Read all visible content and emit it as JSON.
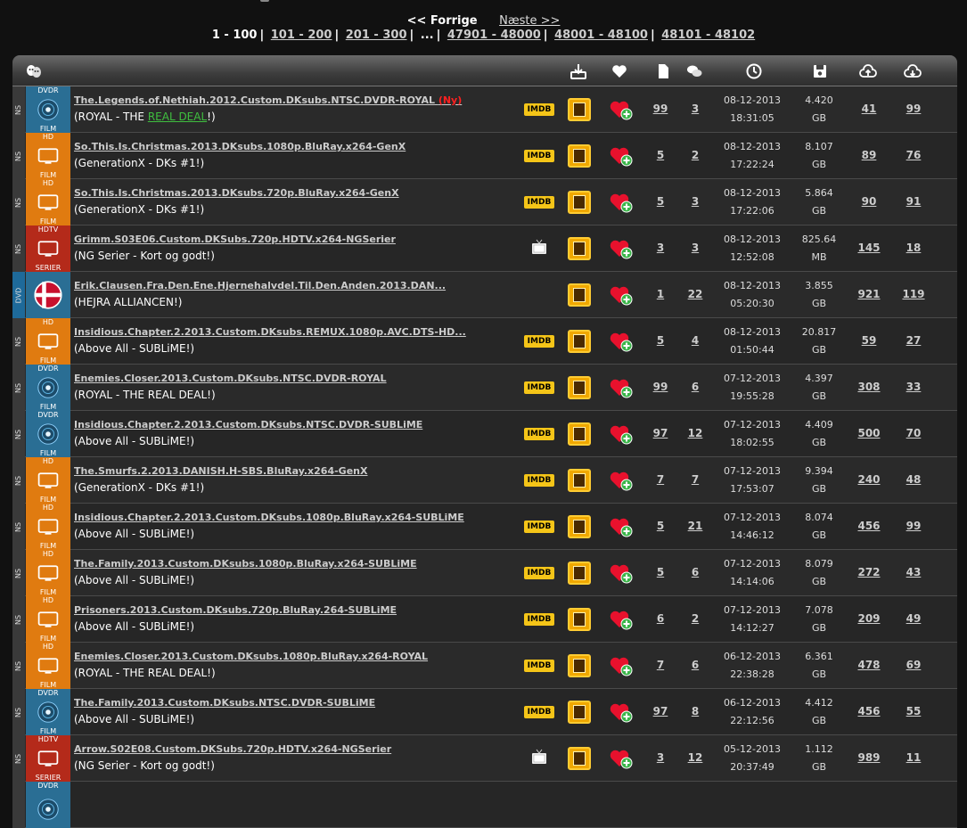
{
  "pager": {
    "prev": "<< Forrige",
    "next": "Næste >>",
    "current": "1 - 100",
    "pages": [
      "101 - 200",
      "201 - 300",
      "...",
      "47901 - 48000",
      "48001 - 48100",
      "48101 - 48102"
    ]
  },
  "header_icons": [
    "masks-icon",
    "download-icon",
    "heart-icon",
    "file-icon",
    "comments-icon",
    "clock-icon",
    "save-icon",
    "upload-cloud-icon",
    "download-cloud-icon"
  ],
  "rows": [
    {
      "side": "NS",
      "cat_top": "DVDR",
      "cat_bottom": "FILM",
      "cat": "blue",
      "icon": "disc",
      "title": "The.Legends.of.Nethiah.2012.Custom.DKsubs.NTSC.DVDR-ROYAL",
      "badge": "(Ny)",
      "sub": "(ROYAL - THE ",
      "sub_green": "REAL DEAL",
      "sub_end": "!)",
      "media": "imdb",
      "files": "99",
      "comments": "3",
      "date": "08-12-2013",
      "time": "18:31:05",
      "size": "4.420",
      "unit": "GB",
      "seeders": "41",
      "leechers": "99"
    },
    {
      "side": "NS",
      "cat_top": "HD",
      "cat_bottom": "FILM",
      "cat": "orange",
      "icon": "tv",
      "title": "So.This.Is.Christmas.2013.DKsubs.1080p.BluRay.x264-GenX",
      "badge": "",
      "sub": "(GenerationX - DKs #1!)",
      "sub_green": "",
      "sub_end": "",
      "media": "imdb",
      "files": "5",
      "comments": "2",
      "date": "08-12-2013",
      "time": "17:22:24",
      "size": "8.107",
      "unit": "GB",
      "seeders": "89",
      "leechers": "76"
    },
    {
      "side": "NS",
      "cat_top": "HD",
      "cat_bottom": "FILM",
      "cat": "orange",
      "icon": "tv",
      "title": "So.This.Is.Christmas.2013.DKsubs.720p.BluRay.x264-GenX",
      "badge": "",
      "sub": "(GenerationX - DKs #1!)",
      "sub_green": "",
      "sub_end": "",
      "media": "imdb",
      "files": "5",
      "comments": "3",
      "date": "08-12-2013",
      "time": "17:22:06",
      "size": "5.864",
      "unit": "GB",
      "seeders": "90",
      "leechers": "91"
    },
    {
      "side": "NS",
      "cat_top": "HDTV",
      "cat_bottom": "SERIER",
      "cat": "red",
      "icon": "tv",
      "title": "Grimm.S03E06.Custom.DKSubs.720p.HDTV.x264-NGSerier",
      "badge": "",
      "sub": "(NG Serier - Kort og godt!)",
      "sub_green": "",
      "sub_end": "",
      "media": "tv",
      "files": "3",
      "comments": "3",
      "date": "08-12-2013",
      "time": "12:52:08",
      "size": "825.64",
      "unit": "MB",
      "seeders": "145",
      "leechers": "18"
    },
    {
      "side": "DVD",
      "cat_top": "",
      "cat_bottom": "",
      "cat": "dk",
      "icon": "flag",
      "title": "Erik.Clausen.Fra.Den.Ene.Hjernehalvdel.Til.Den.Anden.2013.DAN...",
      "badge": "",
      "sub": "(HEJRA ALLIANCEN!)",
      "sub_green": "",
      "sub_end": "",
      "media": "",
      "files": "1",
      "comments": "22",
      "date": "08-12-2013",
      "time": "05:20:30",
      "size": "3.855",
      "unit": "GB",
      "seeders": "921",
      "leechers": "119"
    },
    {
      "side": "NS",
      "cat_top": "HD",
      "cat_bottom": "FILM",
      "cat": "orange",
      "icon": "tv",
      "title": "Insidious.Chapter.2.2013.Custom.DKsubs.REMUX.1080p.AVC.DTS-HD...",
      "badge": "",
      "sub": "(Above All - SUBLiME!)",
      "sub_green": "",
      "sub_end": "",
      "media": "imdb",
      "files": "5",
      "comments": "4",
      "date": "08-12-2013",
      "time": "01:50:44",
      "size": "20.817",
      "unit": "GB",
      "seeders": "59",
      "leechers": "27"
    },
    {
      "side": "NS",
      "cat_top": "DVDR",
      "cat_bottom": "FILM",
      "cat": "blue",
      "icon": "disc",
      "title": "Enemies.Closer.2013.Custom.DKsubs.NTSC.DVDR-ROYAL",
      "badge": "",
      "sub": "(ROYAL - THE REAL DEAL!)",
      "sub_green": "",
      "sub_end": "",
      "media": "imdb",
      "files": "99",
      "comments": "6",
      "date": "07-12-2013",
      "time": "19:55:28",
      "size": "4.397",
      "unit": "GB",
      "seeders": "308",
      "leechers": "33"
    },
    {
      "side": "NS",
      "cat_top": "DVDR",
      "cat_bottom": "FILM",
      "cat": "blue",
      "icon": "disc",
      "title": "Insidious.Chapter.2.2013.Custom.DKsubs.NTSC.DVDR-SUBLiME",
      "badge": "",
      "sub": "(Above All - SUBLiME!)",
      "sub_green": "",
      "sub_end": "",
      "media": "imdb",
      "files": "97",
      "comments": "12",
      "date": "07-12-2013",
      "time": "18:02:55",
      "size": "4.409",
      "unit": "GB",
      "seeders": "500",
      "leechers": "70"
    },
    {
      "side": "NS",
      "cat_top": "HD",
      "cat_bottom": "FILM",
      "cat": "orange",
      "icon": "tv",
      "title": "The.Smurfs.2.2013.DANISH.H-SBS.BluRay.x264-GenX",
      "badge": "",
      "sub": "(GenerationX - DKs #1!)",
      "sub_green": "",
      "sub_end": "",
      "media": "imdb",
      "files": "7",
      "comments": "7",
      "date": "07-12-2013",
      "time": "17:53:07",
      "size": "9.394",
      "unit": "GB",
      "seeders": "240",
      "leechers": "48"
    },
    {
      "side": "NS",
      "cat_top": "HD",
      "cat_bottom": "FILM",
      "cat": "orange",
      "icon": "tv",
      "title": "Insidious.Chapter.2.2013.Custom.DKsubs.1080p.BluRay.x264-SUBLiME",
      "badge": "",
      "sub": "(Above All - SUBLiME!)",
      "sub_green": "",
      "sub_end": "",
      "media": "imdb",
      "files": "5",
      "comments": "21",
      "date": "07-12-2013",
      "time": "14:46:12",
      "size": "8.074",
      "unit": "GB",
      "seeders": "456",
      "leechers": "99"
    },
    {
      "side": "NS",
      "cat_top": "HD",
      "cat_bottom": "FILM",
      "cat": "orange",
      "icon": "tv",
      "title": "The.Family.2013.Custom.DKsubs.1080p.BluRay.x264-SUBLiME",
      "badge": "",
      "sub": "(Above All - SUBLiME!)",
      "sub_green": "",
      "sub_end": "",
      "media": "imdb",
      "files": "5",
      "comments": "6",
      "date": "07-12-2013",
      "time": "14:14:06",
      "size": "8.079",
      "unit": "GB",
      "seeders": "272",
      "leechers": "43"
    },
    {
      "side": "NS",
      "cat_top": "HD",
      "cat_bottom": "FILM",
      "cat": "orange",
      "icon": "tv",
      "title": "Prisoners.2013.Custom.DKsubs.720p.BluRay.264-SUBLiME",
      "badge": "",
      "sub": "(Above All - SUBLiME!)",
      "sub_green": "",
      "sub_end": "",
      "media": "imdb",
      "files": "6",
      "comments": "2",
      "date": "07-12-2013",
      "time": "14:12:27",
      "size": "7.078",
      "unit": "GB",
      "seeders": "209",
      "leechers": "49"
    },
    {
      "side": "NS",
      "cat_top": "HD",
      "cat_bottom": "FILM",
      "cat": "orange",
      "icon": "tv",
      "title": "Enemies.Closer.2013.Custom.DKsubs.1080p.BluRay.x264-ROYAL",
      "badge": "",
      "sub": "(ROYAL - THE REAL DEAL!)",
      "sub_green": "",
      "sub_end": "",
      "media": "imdb",
      "files": "7",
      "comments": "6",
      "date": "06-12-2013",
      "time": "22:38:28",
      "size": "6.361",
      "unit": "GB",
      "seeders": "478",
      "leechers": "69"
    },
    {
      "side": "NS",
      "cat_top": "DVDR",
      "cat_bottom": "FILM",
      "cat": "blue",
      "icon": "disc",
      "title": "The.Family.2013.Custom.DKsubs.NTSC.DVDR-SUBLiME",
      "badge": "",
      "sub": "(Above All - SUBLiME!)",
      "sub_green": "",
      "sub_end": "",
      "media": "imdb",
      "files": "97",
      "comments": "8",
      "date": "06-12-2013",
      "time": "22:12:56",
      "size": "4.412",
      "unit": "GB",
      "seeders": "456",
      "leechers": "55"
    },
    {
      "side": "NS",
      "cat_top": "HDTV",
      "cat_bottom": "SERIER",
      "cat": "red",
      "icon": "tv",
      "title": "Arrow.S02E08.Custom.DKSubs.720p.HDTV.x264-NGSerier",
      "badge": "",
      "sub": "(NG Serier - Kort og godt!)",
      "sub_green": "",
      "sub_end": "",
      "media": "tv",
      "files": "3",
      "comments": "12",
      "date": "05-12-2013",
      "time": "20:37:49",
      "size": "1.112",
      "unit": "GB",
      "seeders": "989",
      "leechers": "11"
    },
    {
      "side": "",
      "cat_top": "DVDR",
      "cat_bottom": "",
      "cat": "blue",
      "icon": "disc",
      "title": "",
      "badge": "",
      "sub": "",
      "sub_green": "",
      "sub_end": "",
      "media": "",
      "files": "",
      "comments": "",
      "date": "",
      "time": "",
      "size": "",
      "unit": "",
      "seeders": "",
      "leechers": ""
    }
  ]
}
